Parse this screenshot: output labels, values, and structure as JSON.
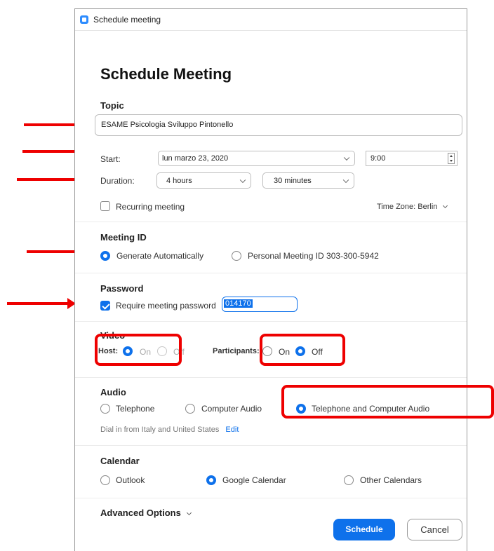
{
  "window": {
    "title": "Schedule meeting"
  },
  "header": {
    "title": "Schedule Meeting"
  },
  "topic": {
    "label": "Topic",
    "value": "ESAME Psicologia Sviluppo Pintonello"
  },
  "start": {
    "label": "Start:",
    "date": "lun  marzo 23, 2020",
    "time": "9:00"
  },
  "duration": {
    "label": "Duration:",
    "hours": "4 hours",
    "minutes": "30 minutes"
  },
  "recurring": {
    "label": "Recurring meeting",
    "checked": false
  },
  "timezone": {
    "label": "Time Zone: Berlin"
  },
  "meeting_id": {
    "label": "Meeting ID",
    "options": [
      "Generate Automatically",
      "Personal Meeting ID 303-300-5942"
    ],
    "selected": "Generate Automatically"
  },
  "password": {
    "label": "Password",
    "require_label": "Require meeting password",
    "checked": true,
    "value": "014170"
  },
  "video": {
    "label": "Video",
    "host_label": "Host:",
    "host_on": "On",
    "host_off": "Off",
    "host_selected": "On",
    "participants_label": "Participants:",
    "participants_on": "On",
    "participants_off": "Off",
    "participants_selected": "Off"
  },
  "audio": {
    "label": "Audio",
    "options": [
      "Telephone",
      "Computer Audio",
      "Telephone and Computer Audio"
    ],
    "selected": "Telephone and Computer Audio",
    "dial_in_text": "Dial in from Italy and United States",
    "edit_link": "Edit"
  },
  "calendar": {
    "label": "Calendar",
    "options": [
      "Outlook",
      "Google Calendar",
      "Other Calendars"
    ],
    "selected": "Google Calendar"
  },
  "advanced": {
    "label": "Advanced Options"
  },
  "buttons": {
    "schedule": "Schedule",
    "cancel": "Cancel"
  },
  "colors": {
    "accent": "#0e71eb",
    "annotation": "#ee0000"
  }
}
